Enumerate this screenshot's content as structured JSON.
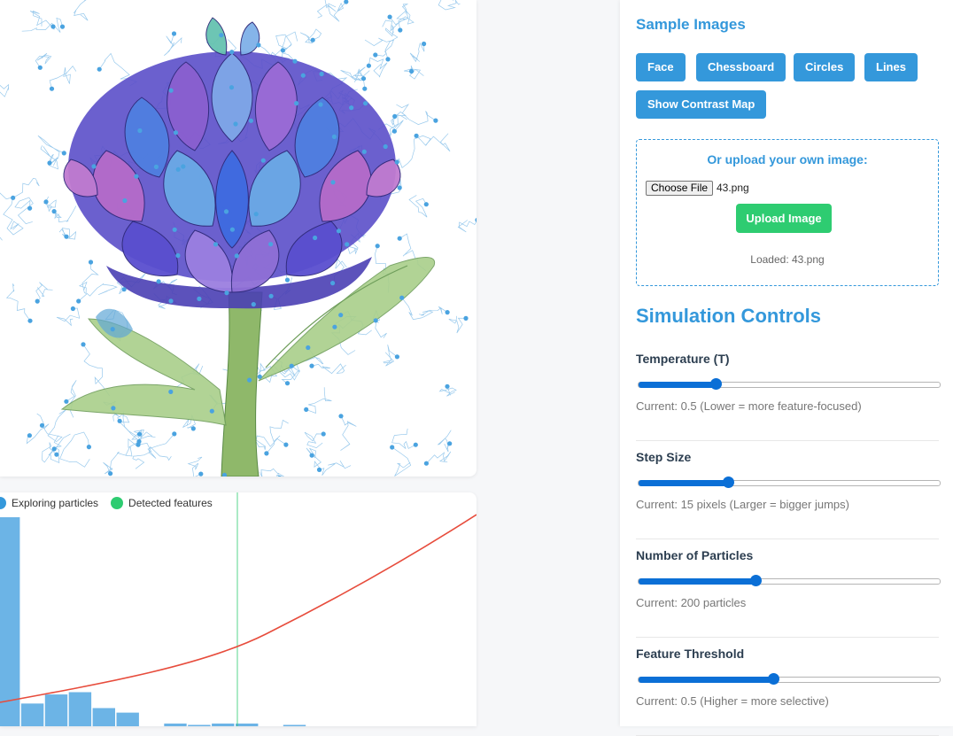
{
  "legend": {
    "exploring": "Exploring particles",
    "detected": "Detected features",
    "exploring_color": "#3498db",
    "detected_color": "#2ecc71"
  },
  "chart_data": {
    "type": "bar",
    "values": [
      46,
      5,
      7,
      7.5,
      4,
      3,
      0,
      0.6,
      0.3,
      0.6,
      0.6,
      0,
      0.3
    ],
    "curve_color": "#e74c3c",
    "marker_color": "#2ecc71",
    "bar_color": "#6cb4e6"
  },
  "sample_images": {
    "title": "Sample Images",
    "buttons": [
      "Face",
      "Chessboard",
      "Circles",
      "Lines"
    ],
    "contrast_button": "Show Contrast Map"
  },
  "upload": {
    "title": "Or upload your own image:",
    "choose_file": "Choose File",
    "file_name": "43.png",
    "upload_button": "Upload Image",
    "status": "Loaded: 43.png"
  },
  "simulation": {
    "title": "Simulation Controls",
    "controls": [
      {
        "label": "Temperature (T)",
        "value_fraction": 0.26,
        "current": "Current: 0.5 (Lower = more feature-focused)"
      },
      {
        "label": "Step Size",
        "value_fraction": 0.3,
        "current": "Current: 15 pixels (Larger = bigger jumps)"
      },
      {
        "label": "Number of Particles",
        "value_fraction": 0.39,
        "current": "Current: 200 particles"
      },
      {
        "label": "Feature Threshold",
        "value_fraction": 0.45,
        "current": "Current: 0.5 (Higher = more selective)"
      }
    ]
  },
  "colors": {
    "accent": "#3498db",
    "success": "#2ecc71",
    "slider": "#0b6fd6"
  }
}
